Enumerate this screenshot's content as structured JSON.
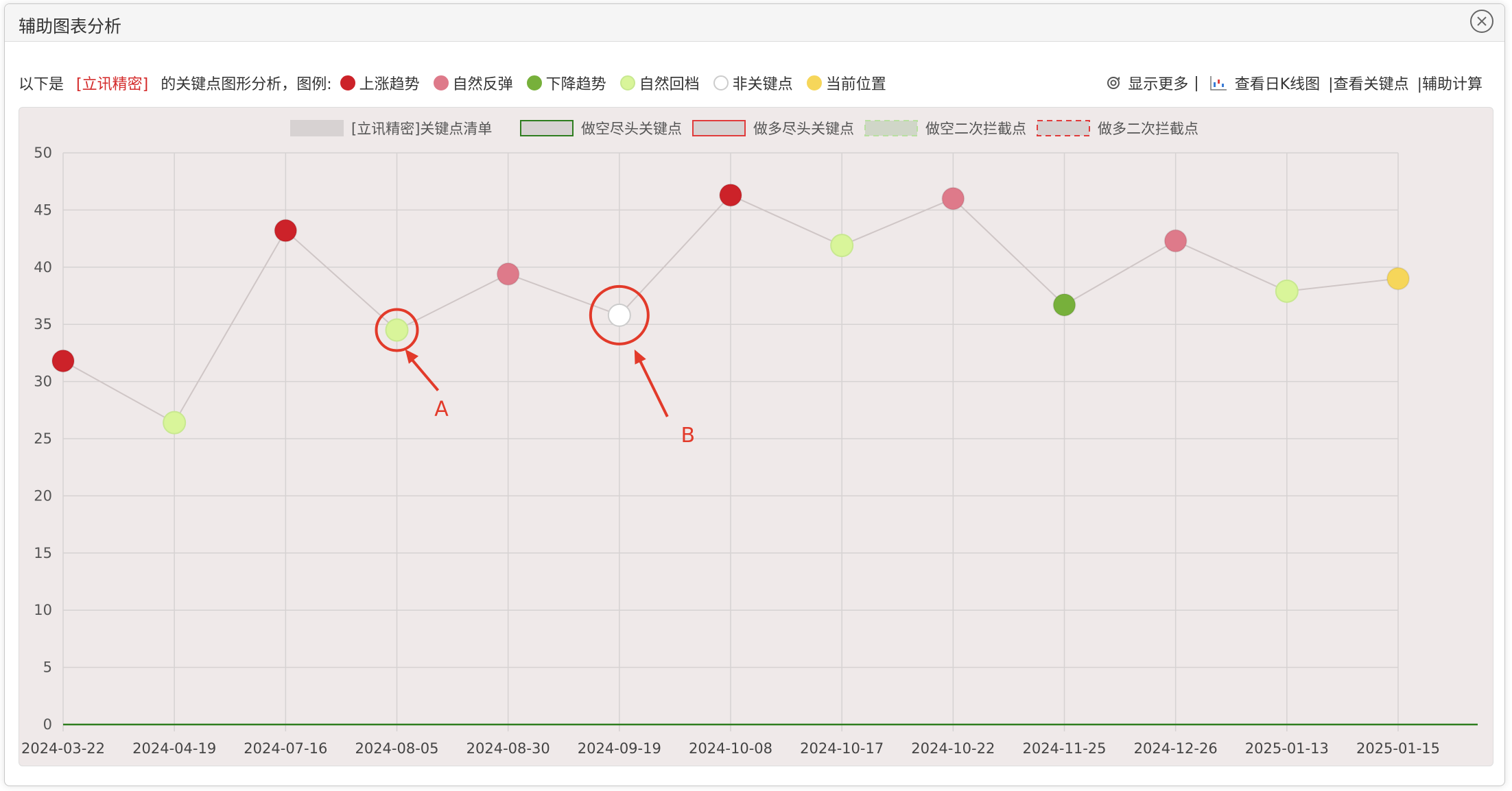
{
  "modal": {
    "title": "辅助图表分析"
  },
  "info": {
    "prefix": "以下是",
    "stock_name": "[立讯精密]",
    "suffix": "的关键点图形分析，图例:",
    "legend": [
      {
        "label": "上涨趋势",
        "color": "#cc2229",
        "border": "#cc2229"
      },
      {
        "label": "自然反弹",
        "color": "#de7a8a",
        "border": "#de7a8a"
      },
      {
        "label": "下降趋势",
        "color": "#77b03b",
        "border": "#77b03b"
      },
      {
        "label": "自然回档",
        "color": "#d9f59a",
        "border": "#c8e890"
      },
      {
        "label": "非关键点",
        "color": "#ffffff",
        "border": "#cccccc"
      },
      {
        "label": "当前位置",
        "color": "#f6d65a",
        "border": "#f6d65a"
      }
    ],
    "links": {
      "show_more": "显示更多",
      "sep": "|",
      "kline": "查看日K线图",
      "keypoints": "|查看关键点",
      "calc": "|辅助计算"
    },
    "icons": {
      "show_more": "refresh-icon",
      "kline": "candlestick-chart-icon",
      "close": "close-circle-icon"
    }
  },
  "chart_data": {
    "type": "line",
    "legend_position": "top-center",
    "legend": [
      {
        "label": "[立讯精密]关键点清单",
        "fill": "#d7d2d2",
        "stroke": "#d7d2d2",
        "dashed": false
      },
      {
        "label": "做空尽头关键点",
        "fill": "#d7d2d2",
        "stroke": "#2e7d1f",
        "dashed": false
      },
      {
        "label": "做多尽头关键点",
        "fill": "#d7d2d2",
        "stroke": "#e03b3b",
        "dashed": false
      },
      {
        "label": "做空二次拦截点",
        "fill": "#d0d6c8",
        "stroke": "#b8e0a0",
        "dashed": true
      },
      {
        "label": "做多二次拦截点",
        "fill": "#d7d2d2",
        "stroke": "#e03b3b",
        "dashed": true
      }
    ],
    "categories": [
      "2024-03-22",
      "2024-04-19",
      "2024-07-16",
      "2024-08-05",
      "2024-08-30",
      "2024-09-19",
      "2024-10-08",
      "2024-10-17",
      "2024-10-22",
      "2024-11-25",
      "2024-12-26",
      "2025-01-13",
      "2025-01-15"
    ],
    "values": [
      31.8,
      26.4,
      43.2,
      34.5,
      39.4,
      35.8,
      46.3,
      41.9,
      46.0,
      36.7,
      42.3,
      37.9,
      39.0
    ],
    "point_types": [
      "上涨趋势",
      "自然回档",
      "上涨趋势",
      "自然回档",
      "自然反弹",
      "非关键点",
      "上涨趋势",
      "自然回档",
      "自然反弹",
      "下降趋势",
      "自然反弹",
      "自然回档",
      "当前位置"
    ],
    "baseline_value": 0,
    "baseline_color": "#2e7d1f",
    "ylim": [
      0,
      50
    ],
    "yticks": [
      0,
      5,
      10,
      15,
      20,
      25,
      30,
      35,
      40,
      45,
      50
    ],
    "grid": true,
    "annotations": [
      {
        "label": "A",
        "category": "2024-08-05",
        "value": 34.5
      },
      {
        "label": "B",
        "category": "2024-09-19",
        "value": 35.8
      }
    ],
    "annotation_color": "#e23a2a"
  }
}
